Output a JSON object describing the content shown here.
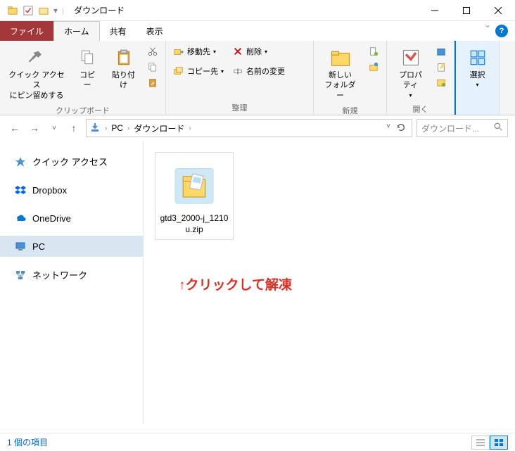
{
  "window": {
    "title": "ダウンロード",
    "separator": "|"
  },
  "tabs": {
    "file": "ファイル",
    "home": "ホーム",
    "share": "共有",
    "view": "表示"
  },
  "ribbon": {
    "clipboard": {
      "pin": "クイック アクセス\nにピン留めする",
      "copy": "コピー",
      "paste": "貼り付け",
      "label": "クリップボード"
    },
    "organize": {
      "moveTo": "移動先",
      "copyTo": "コピー先",
      "delete": "削除",
      "rename": "名前の変更",
      "label": "整理"
    },
    "new": {
      "newFolder": "新しい\nフォルダー",
      "label": "新規"
    },
    "open": {
      "properties": "プロパティ",
      "label": "開く"
    },
    "select": {
      "select": "選択"
    }
  },
  "breadcrumb": {
    "pc": "PC",
    "downloads": "ダウンロード"
  },
  "search": {
    "placeholder": "ダウンロード..."
  },
  "nav": {
    "quickAccess": "クイック アクセス",
    "dropbox": "Dropbox",
    "onedrive": "OneDrive",
    "pc": "PC",
    "network": "ネットワーク"
  },
  "files": [
    {
      "name": "gtd3_2000-j_1210u.zip"
    }
  ],
  "annotation": "↑クリックして解凍",
  "statusbar": {
    "itemCount": "1 個の項目"
  },
  "colors": {
    "fileTab": "#a4373a",
    "accent": "#0078d4",
    "annotation": "#d93025"
  }
}
